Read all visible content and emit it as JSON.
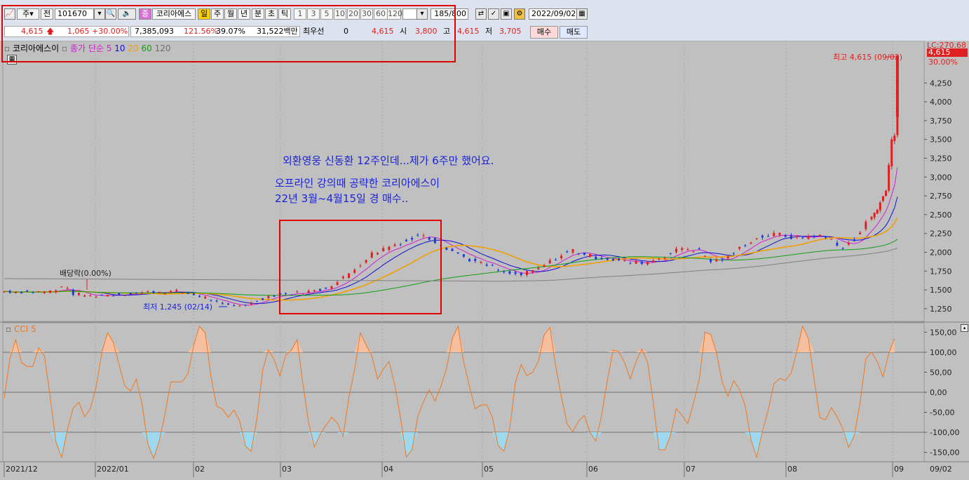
{
  "toolbar": {
    "period_select": "주",
    "prev_label": "전",
    "code": "101670",
    "stock_name_badge": "종",
    "stock_name": "코리아에스",
    "periods": [
      "일",
      "주",
      "월",
      "년",
      "분",
      "초",
      "틱"
    ],
    "minute_options": [
      "1",
      "3",
      "5",
      "10",
      "20",
      "30",
      "60",
      "120"
    ],
    "count": "185/800",
    "date": "2022/09/02"
  },
  "quote": {
    "price": "4,615",
    "change": "1,065",
    "change_pct": "+30.00%",
    "volume": "7,385,093",
    "vol_ratio": "121.56%",
    "turnover": "39.07%",
    "amount": "31,522백만",
    "seller_label": "최우선",
    "seller_value": "0",
    "price2": "4,615",
    "open_label": "시",
    "open": "3,800",
    "high_label": "고",
    "high": "4,615",
    "low_label": "저",
    "low": "3,705",
    "buy_label": "매수",
    "sell_label": "매도"
  },
  "legend": {
    "name": "코리아에스이",
    "ma_title": "종가 단순",
    "ma_periods": [
      "5",
      "10",
      "20",
      "60",
      "120"
    ],
    "ma_colors": [
      "#d020d0",
      "#1010d0",
      "#f0a000",
      "#10a010",
      "#808080"
    ]
  },
  "chart_data": [
    {
      "type": "candlestick",
      "title": "",
      "ylim": [
        1100,
        4700
      ],
      "y_ticks": [
        "4,250",
        "4,000",
        "3,750",
        "3,500",
        "3,250",
        "3,000",
        "2,750",
        "2,500",
        "2,250",
        "2,000",
        "1,750",
        "1,500",
        "1,250"
      ],
      "scale_label": "LC:270.68",
      "last_price": "4,615",
      "last_pct": "30.00%",
      "annotations": {
        "high": "최고 4,615 (09/02)",
        "low": "최저 1,245 (02/14)",
        "dividend": "배당락(0.00%)"
      },
      "ohlc_rough": [
        {
          "o": 1480,
          "h": 1520,
          "l": 1440,
          "c": 1490
        },
        {
          "o": 1500,
          "h": 1560,
          "l": 1460,
          "c": 1480
        },
        {
          "o": 1480,
          "h": 1750,
          "l": 1470,
          "c": 1700
        },
        {
          "o": 1450,
          "h": 1480,
          "l": 1360,
          "c": 1380
        },
        {
          "o": 1300,
          "h": 1320,
          "l": 1245,
          "c": 1290
        },
        {
          "o": 1350,
          "h": 1460,
          "l": 1330,
          "c": 1440
        },
        {
          "o": 1480,
          "h": 1700,
          "l": 1470,
          "c": 1680
        },
        {
          "o": 1900,
          "h": 2120,
          "l": 1880,
          "c": 2080
        },
        {
          "o": 2200,
          "h": 2280,
          "l": 2120,
          "c": 2250
        },
        {
          "o": 2050,
          "h": 2080,
          "l": 1800,
          "c": 1850
        },
        {
          "o": 1750,
          "h": 1800,
          "l": 1620,
          "c": 1680
        },
        {
          "o": 1900,
          "h": 2050,
          "l": 1880,
          "c": 2010
        },
        {
          "o": 1880,
          "h": 1950,
          "l": 1760,
          "c": 1820
        },
        {
          "o": 2000,
          "h": 2120,
          "l": 1960,
          "c": 2080
        },
        {
          "o": 2200,
          "h": 2300,
          "l": 2150,
          "c": 2260
        },
        {
          "o": 2150,
          "h": 2200,
          "l": 2050,
          "c": 2080
        },
        {
          "o": 2450,
          "h": 2700,
          "l": 2400,
          "c": 2600
        },
        {
          "o": 2900,
          "h": 3550,
          "l": 2850,
          "c": 3550
        },
        {
          "o": 3800,
          "h": 4615,
          "l": 3705,
          "c": 4615
        }
      ]
    },
    {
      "type": "line",
      "title": "CCI 5",
      "ylim": [
        -170,
        170
      ],
      "y_ticks": [
        "150,00",
        "100,00",
        "50,00",
        "0,00",
        "-50,00",
        "-100,00",
        "-150,00"
      ],
      "reference_lines": [
        100,
        0,
        -100
      ]
    }
  ],
  "x_axis": {
    "labels": [
      "2021/12",
      "2022/01",
      "02",
      "03",
      "04",
      "05",
      "06",
      "07",
      "08",
      "09"
    ],
    "end_label": "09/02"
  },
  "notes": {
    "line1": "외환영웅 신동환 12주인데...제가 6주만 했어요.",
    "line2": "오프라인 강의때 공략한 코리아에스이",
    "line3": "22년 3월~4월15일 경 매수.."
  },
  "colors": {
    "up": "#e02020",
    "down": "#1a3cd8",
    "cci": "#f07820",
    "cci_fill_up": "#f6bfa0",
    "cci_fill_down": "#9ed8ee",
    "highlight": "#e00000"
  }
}
